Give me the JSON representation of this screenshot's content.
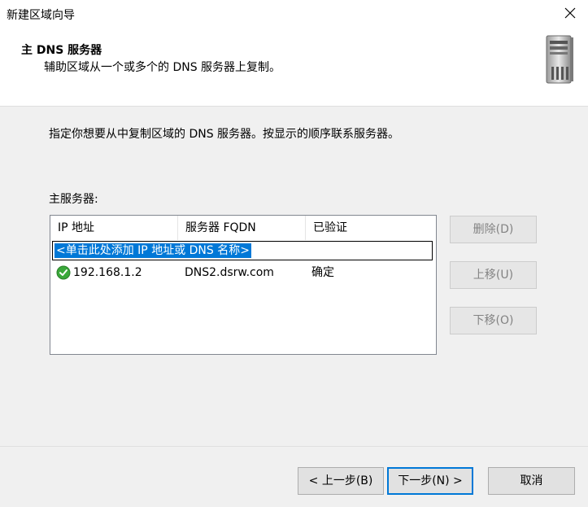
{
  "window": {
    "title": "新建区域向导",
    "close_icon": "close-icon"
  },
  "header": {
    "title": "主 DNS 服务器",
    "subtitle": "辅助区域从一个或多个的 DNS 服务器上复制。",
    "icon": "server-icon"
  },
  "instruction": "指定你想要从中复制区域的 DNS 服务器。按显示的顺序联系服务器。",
  "list": {
    "label": "主服务器:",
    "columns": [
      "IP 地址",
      "服务器 FQDN",
      "已验证"
    ],
    "add_prompt": "<单击此处添加 IP 地址或 DNS 名称>",
    "rows": [
      {
        "ip": "192.168.1.2",
        "fqdn": "DNS2.dsrw.com",
        "verified": "确定",
        "status_icon": "check-circle-icon"
      }
    ]
  },
  "side_buttons": {
    "delete": "删除(D)",
    "up": "上移(U)",
    "down": "下移(O)"
  },
  "footer": {
    "back": "< 上一步(B)",
    "next": "下一步(N) >",
    "cancel": "取消"
  },
  "colors": {
    "selection": "#0078d7",
    "check": "#3aa83a",
    "default_button_border": "#0078d7"
  }
}
